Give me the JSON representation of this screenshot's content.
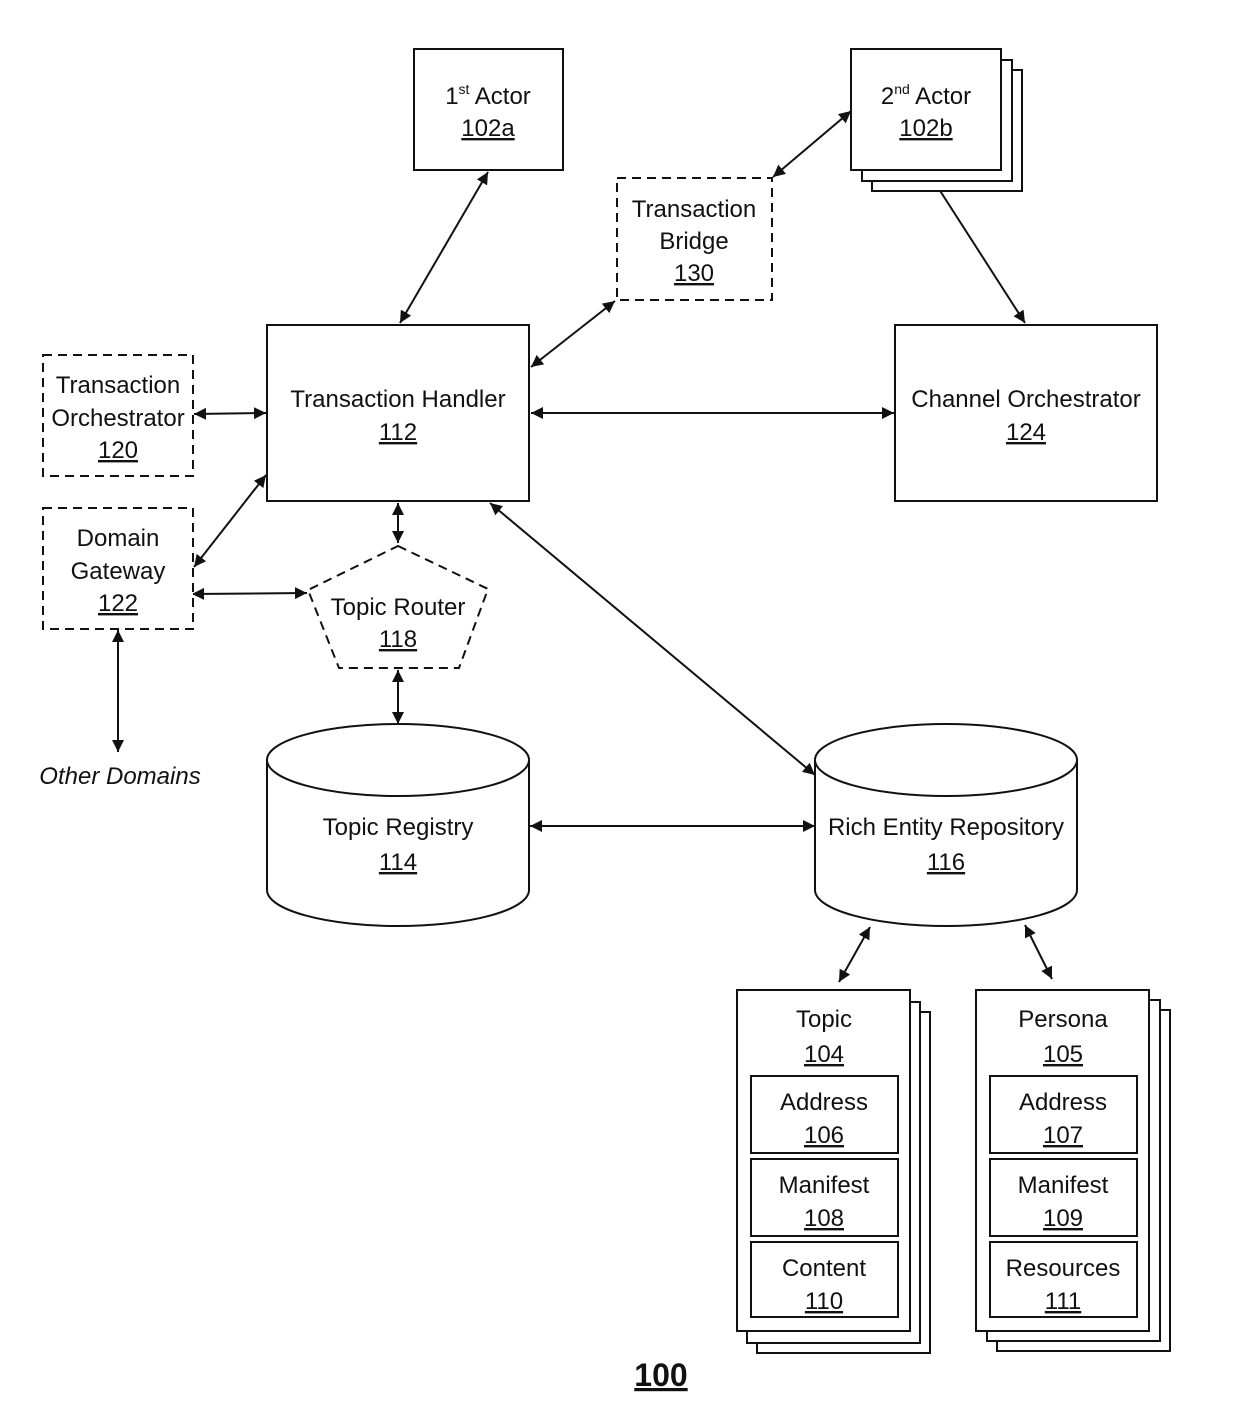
{
  "figure": {
    "number": "100"
  },
  "nodes": {
    "actor1": {
      "title_main": "1",
      "title_sup": "st",
      "title_rest": " Actor",
      "ref": "102a"
    },
    "actor2": {
      "title_main": "2",
      "title_sup": "nd",
      "title_rest": " Actor",
      "ref": "102b"
    },
    "bridge": {
      "line1": "Transaction",
      "line2": "Bridge",
      "ref": "130"
    },
    "handler": {
      "title": "Transaction Handler",
      "ref": "112"
    },
    "orchestrator": {
      "line1": "Transaction",
      "line2": "Orchestrator",
      "ref": "120"
    },
    "gateway": {
      "line1": "Domain",
      "line2": "Gateway",
      "ref": "122"
    },
    "channel": {
      "title": "Channel Orchestrator",
      "ref": "124"
    },
    "router": {
      "title": "Topic Router",
      "ref": "118"
    },
    "other_domains": {
      "title": "Other Domains"
    },
    "registry": {
      "title": "Topic Registry",
      "ref": "114"
    },
    "repository": {
      "title": "Rich Entity Repository",
      "ref": "116"
    },
    "topic": {
      "title": "Topic",
      "ref": "104",
      "parts": [
        {
          "title": "Address",
          "ref": "106"
        },
        {
          "title": "Manifest",
          "ref": "108"
        },
        {
          "title": "Content",
          "ref": "110"
        }
      ]
    },
    "persona": {
      "title": "Persona",
      "ref": "105",
      "parts": [
        {
          "title": "Address",
          "ref": "107"
        },
        {
          "title": "Manifest",
          "ref": "109"
        },
        {
          "title": "Resources",
          "ref": "111"
        }
      ]
    }
  },
  "connections": [
    {
      "from": "Transaction Handler 112",
      "to": "1st Actor 102a",
      "direction": "bidirectional"
    },
    {
      "from": "Transaction Handler 112",
      "to": "Transaction Bridge 130",
      "direction": "bidirectional"
    },
    {
      "from": "Transaction Bridge 130",
      "to": "2nd Actor 102b",
      "direction": "bidirectional"
    },
    {
      "from": "2nd Actor 102b",
      "to": "Channel Orchestrator 124",
      "direction": "bidirectional"
    },
    {
      "from": "Transaction Orchestrator 120",
      "to": "Transaction Handler 112",
      "direction": "bidirectional"
    },
    {
      "from": "Transaction Handler 112",
      "to": "Channel Orchestrator 124",
      "direction": "bidirectional"
    },
    {
      "from": "Domain Gateway 122",
      "to": "Transaction Handler 112",
      "direction": "bidirectional"
    },
    {
      "from": "Domain Gateway 122",
      "to": "Topic Router 118",
      "direction": "bidirectional"
    },
    {
      "from": "Domain Gateway 122",
      "to": "Other Domains",
      "direction": "bidirectional"
    },
    {
      "from": "Transaction Handler 112",
      "to": "Topic Router 118",
      "direction": "bidirectional"
    },
    {
      "from": "Topic Router 118",
      "to": "Topic Registry 114",
      "direction": "bidirectional"
    },
    {
      "from": "Transaction Handler 112",
      "to": "Rich Entity Repository 116",
      "direction": "bidirectional"
    },
    {
      "from": "Topic Registry 114",
      "to": "Rich Entity Repository 116",
      "direction": "bidirectional"
    },
    {
      "from": "Rich Entity Repository 116",
      "to": "Topic 104",
      "direction": "bidirectional"
    },
    {
      "from": "Rich Entity Repository 116",
      "to": "Persona 105",
      "direction": "bidirectional"
    }
  ]
}
